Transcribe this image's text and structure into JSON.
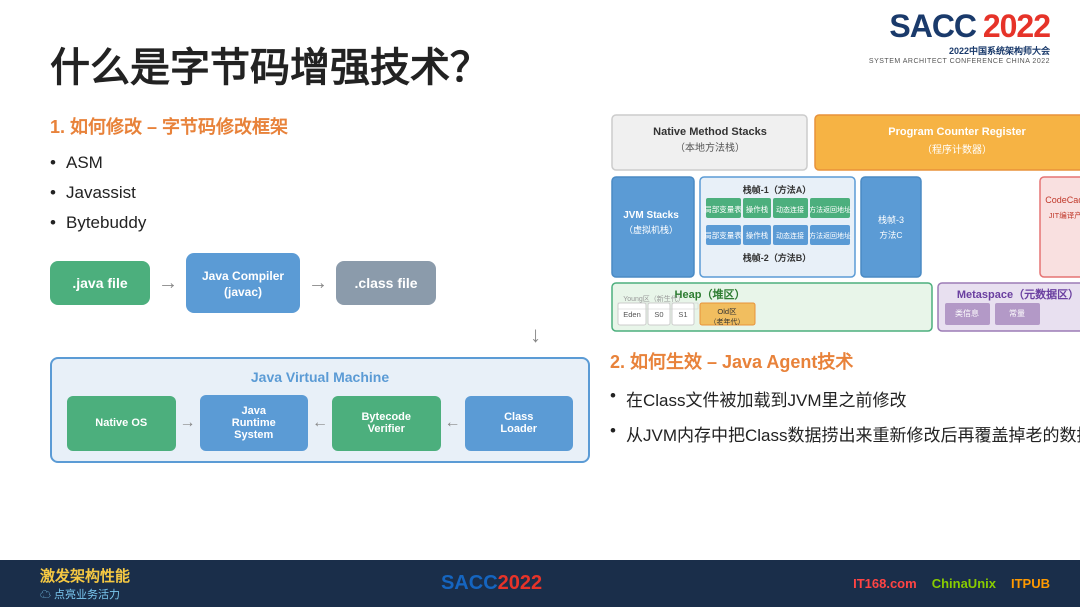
{
  "slide": {
    "title": "什么是字节码增强技术？",
    "logo": {
      "sacc": "SACC",
      "year_red": "2022",
      "subtitle": "2022中国系统架构师大会",
      "subtitle_en": "SYSTEM ARCHITECT CONFERENCE CHINA 2022"
    },
    "section1": {
      "heading": "1. 如何修改 – 字节码修改框架",
      "bullets": [
        "ASM",
        "Javassist",
        "Bytebuddy"
      ]
    },
    "flow": {
      "java_file": ".java file",
      "compiler": "Java Compiler\n(javac)",
      "class_file": ".class file",
      "arrow": "→"
    },
    "jvm_container": {
      "title": "Java Virtual Machine",
      "native_os": "Native OS",
      "runtime": "Java\nRuntime\nSystem",
      "verifier": "Bytecode\nVerifier",
      "loader": "Class\nLoader"
    },
    "section2": {
      "heading": "2. 如何生效 – Java Agent技术",
      "bullet1": "在Class文件被加载到JVM里之前修改",
      "bullet2": "从JVM内存中把Class数据捞出来重新修改后再覆盖掉老的数据"
    },
    "jvm_memory": {
      "native_stacks": "Native Method Stacks\n（本地方法栈）",
      "program_counter": "Program Counter Register\n（程序计数器）",
      "jvm_stacks": "JVM Stacks\n（虚拟机栈）",
      "frame1": "栈帧-1（方法A）",
      "frame2": "栈帧-2（方法B）",
      "frame3": "栈帧-3",
      "heap": "Heap（堆区）",
      "metaspace": "Metaspace（元数据区）",
      "eden": "Eden",
      "s0": "S0",
      "s1": "S1",
      "old": "Old区\n（老年代）",
      "young": "Young区\n（新生代）",
      "codecache": "CodeCache\nJIT编译产物"
    },
    "bottom": {
      "slogan1": "激发架构性能",
      "slogan2": "☁ 点亮业务活力",
      "sacc_label": "SACC",
      "year_label": "2022",
      "partner1": "IT168.com",
      "partner2": "ChinaUnix",
      "partner3": "ITPUB"
    }
  }
}
